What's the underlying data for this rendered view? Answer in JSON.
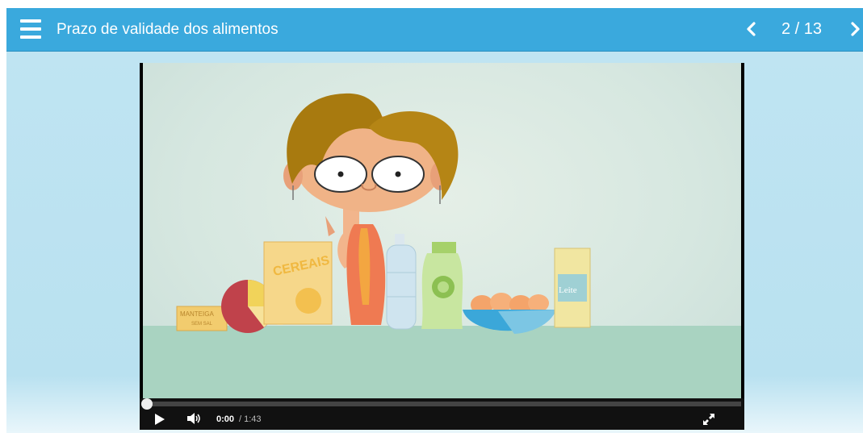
{
  "header": {
    "title": "Prazo de validade dos alimentos",
    "page_counter": "2 / 13",
    "menu_icon": "hamburger-menu-icon",
    "prev_icon": "chevron-left-icon",
    "next_icon": "chevron-right-icon"
  },
  "video": {
    "current_time": "0:00",
    "duration": "/ 1:43",
    "progress": 0.0,
    "play_icon": "play-icon",
    "volume_icon": "volume-icon",
    "fullscreen_icon": "fullscreen-icon",
    "scene_texts": {
      "cereal": "CEREAIS",
      "butter": "MANTEIGA",
      "butter_sub": "SEM SAL",
      "milk": "Leite"
    }
  },
  "colors": {
    "header": "#3aa9dd",
    "stage": "#bfe4f2",
    "controls": "#111111"
  }
}
